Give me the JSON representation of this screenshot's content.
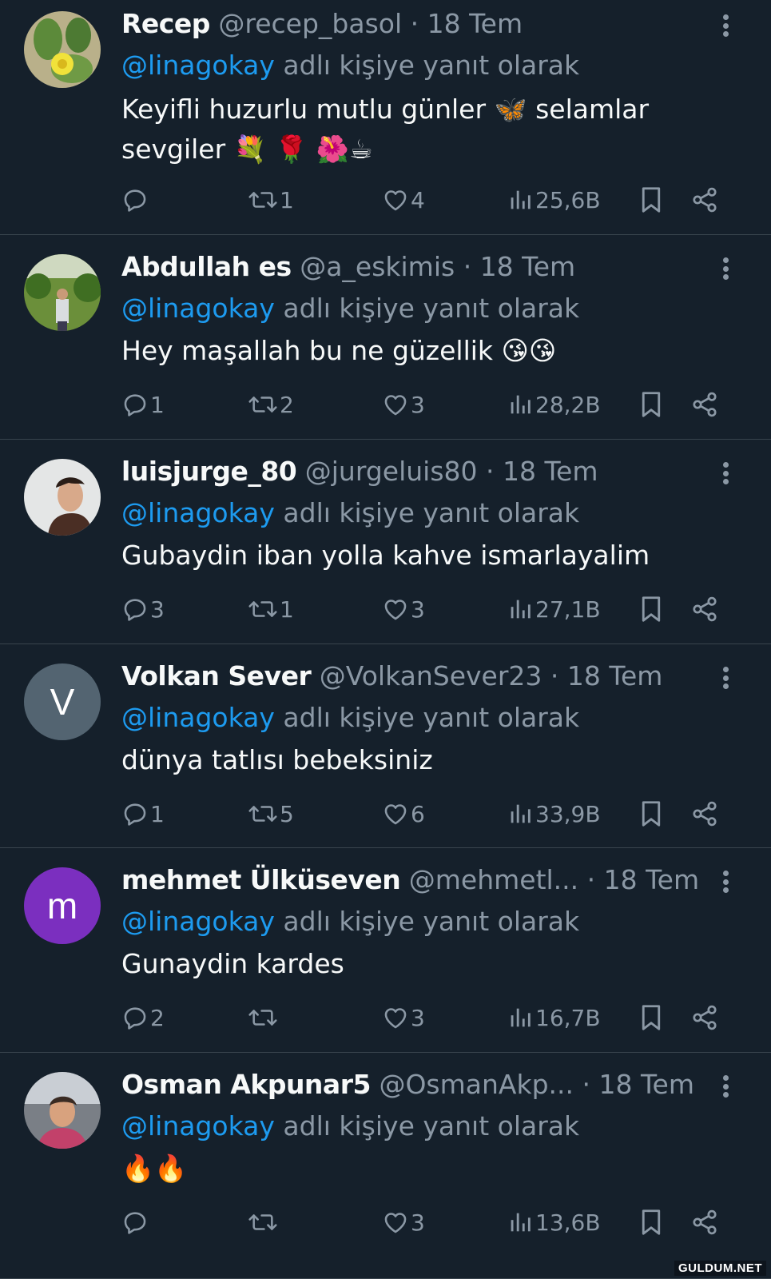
{
  "colors": {
    "background": "#15202b",
    "text": "#f7f9f9",
    "muted": "#8b98a5",
    "mention": "#1d9bf0",
    "divider": "#38444d"
  },
  "tweets": [
    {
      "name": "Recep",
      "handle": "@recep_basol",
      "time": "18 Tem",
      "reply_mention": "@linagokay",
      "reply_suffix": "adlı kişiye yanıt olarak",
      "text": "Keyifli huzurlu mutlu günler 🦋 selamlar sevgiler 💐 🌹 🌺☕",
      "replies": "",
      "retweets": "1",
      "likes": "4",
      "views": "25,6B",
      "avatar": {
        "type": "photo",
        "icon": "cactus-flower-avatar"
      }
    },
    {
      "name": "Abdullah es",
      "handle": "@a_eskimis",
      "time": "18 Tem",
      "reply_mention": "@linagokay",
      "reply_suffix": "adlı kişiye yanıt olarak",
      "text": "Hey maşallah bu ne güzellik 😘😘",
      "replies": "1",
      "retweets": "2",
      "likes": "3",
      "views": "28,2B",
      "avatar": {
        "type": "photo",
        "icon": "man-in-garden-avatar"
      }
    },
    {
      "name": "luisjurge_80",
      "handle": "@jurgeluis80",
      "time": "18 Tem",
      "reply_mention": "@linagokay",
      "reply_suffix": "adlı kişiye yanıt olarak",
      "text": "Gubaydin iban yolla kahve ismarlayalim",
      "replies": "3",
      "retweets": "1",
      "likes": "3",
      "views": "27,1B",
      "avatar": {
        "type": "photo",
        "icon": "man-portrait-avatar"
      }
    },
    {
      "name": "Volkan Sever",
      "handle": "@VolkanSever23",
      "time": "18 Tem",
      "reply_mention": "@linagokay",
      "reply_suffix": "adlı kişiye yanıt olarak",
      "text": "dünya tatlısı bebeksiniz",
      "replies": "1",
      "retweets": "5",
      "likes": "6",
      "views": "33,9B",
      "avatar": {
        "type": "letter",
        "letter": "V",
        "color": "#536471"
      }
    },
    {
      "name": "mehmet Ülküseven",
      "handle": "@mehmetl...",
      "time": "18 Tem",
      "reply_mention": "@linagokay",
      "reply_suffix": "adlı kişiye yanıt olarak",
      "text": "Gunaydin kardes",
      "replies": "2",
      "retweets": "",
      "likes": "3",
      "views": "16,7B",
      "avatar": {
        "type": "letter",
        "letter": "m",
        "color": "#7b2fbf"
      }
    },
    {
      "name": "Osman Akpunar5",
      "handle": "@OsmanAkp...",
      "time": "18 Tem",
      "reply_mention": "@linagokay",
      "reply_suffix": "adlı kişiye yanıt olarak",
      "text": "🔥🔥",
      "replies": "",
      "retweets": "",
      "likes": "3",
      "views": "13,6B",
      "avatar": {
        "type": "photo",
        "icon": "woman-portrait-avatar"
      }
    }
  ],
  "watermark": "GULDUM.NET"
}
